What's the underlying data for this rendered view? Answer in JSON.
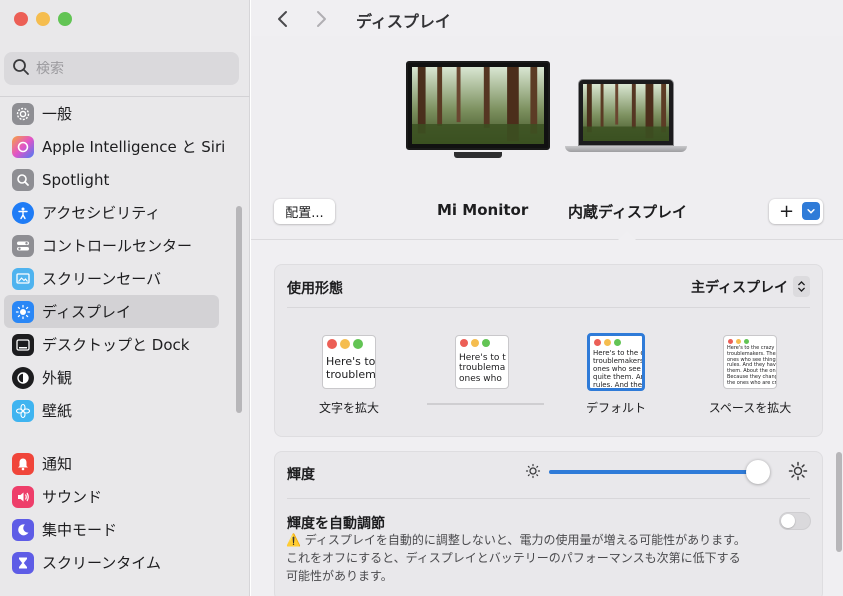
{
  "window": {
    "traffic_lights": [
      "#ec5f56",
      "#f5bd4f",
      "#62c454"
    ]
  },
  "sidebar": {
    "search_placeholder": "検索",
    "items": [
      {
        "label": "一般",
        "icon": "gear-icon",
        "color": "#8e8e93"
      },
      {
        "label": "Apple Intelligence と Siri",
        "icon": "siri-icon",
        "color": "#e06ad2"
      },
      {
        "label": "Spotlight",
        "icon": "magnifier-icon",
        "color": "#8e8e93"
      },
      {
        "label": "アクセシビリティ",
        "icon": "accessibility-icon",
        "color": "#1f7cf6"
      },
      {
        "label": "コントロールセンター",
        "icon": "toggles-icon",
        "color": "#8e8e93"
      },
      {
        "label": "スクリーンセーバ",
        "icon": "screensaver-icon",
        "color": "#4fb3ef"
      },
      {
        "label": "ディスプレイ",
        "icon": "sun-icon",
        "color": "#2a87f6"
      },
      {
        "label": "デスクトップと Dock",
        "icon": "dock-icon",
        "color": "#1d1d1f"
      },
      {
        "label": "外観",
        "icon": "appearance-icon",
        "color": "#1d1d1f"
      },
      {
        "label": "壁紙",
        "icon": "flower-icon",
        "color": "#3fb4f0"
      },
      {
        "label": "通知",
        "icon": "bell-icon",
        "color": "#f0453a"
      },
      {
        "label": "サウンド",
        "icon": "speaker-icon",
        "color": "#ee3e6a"
      },
      {
        "label": "集中モード",
        "icon": "moon-icon",
        "color": "#5e5ce6"
      },
      {
        "label": "スクリーンタイム",
        "icon": "hourglass-icon",
        "color": "#5e5ce6"
      }
    ],
    "active_index": 6
  },
  "header": {
    "title": "ディスプレイ"
  },
  "displays": {
    "arrange_button": "配置...",
    "external_label": "Mi Monitor",
    "internal_label": "内蔵ディスプレイ",
    "add_button": "+"
  },
  "usage": {
    "label": "使用形態",
    "value": "主ディスプレイ"
  },
  "resolution": {
    "options": [
      {
        "label": "文字を拡大",
        "preview_text": "Here's to t\ntroublem"
      },
      {
        "label": "",
        "preview_text": "Here's to t\ntroublema\nones who"
      },
      {
        "label": "デフォルト",
        "preview_text": "Here's to the cr\ntroublemakers.\nones who see t\nquite them. And\nrules. And they"
      },
      {
        "label": "スペースを拡大",
        "preview_text": "Here's to the crazy one\ntroublemakers. The rou\nones who see things dif\nrules. And they have no\nthem. About the only th\nBecause they change t\nthe ones who are craz"
      }
    ],
    "selected_index": 2
  },
  "brightness": {
    "label": "輝度",
    "value_fraction": 0.96,
    "accent": "#2f7bd8"
  },
  "auto_brightness": {
    "label": "輝度を自動調節",
    "enabled": false,
    "note_line1": "⚠️ ディスプレイを自動的に調整しないと、電力の使用量が増える可能性があります。",
    "note_line2": "これをオフにすると、ディスプレイとバッテリーのパフォーマンスも次第に低下する",
    "note_line3": "可能性があります。"
  }
}
